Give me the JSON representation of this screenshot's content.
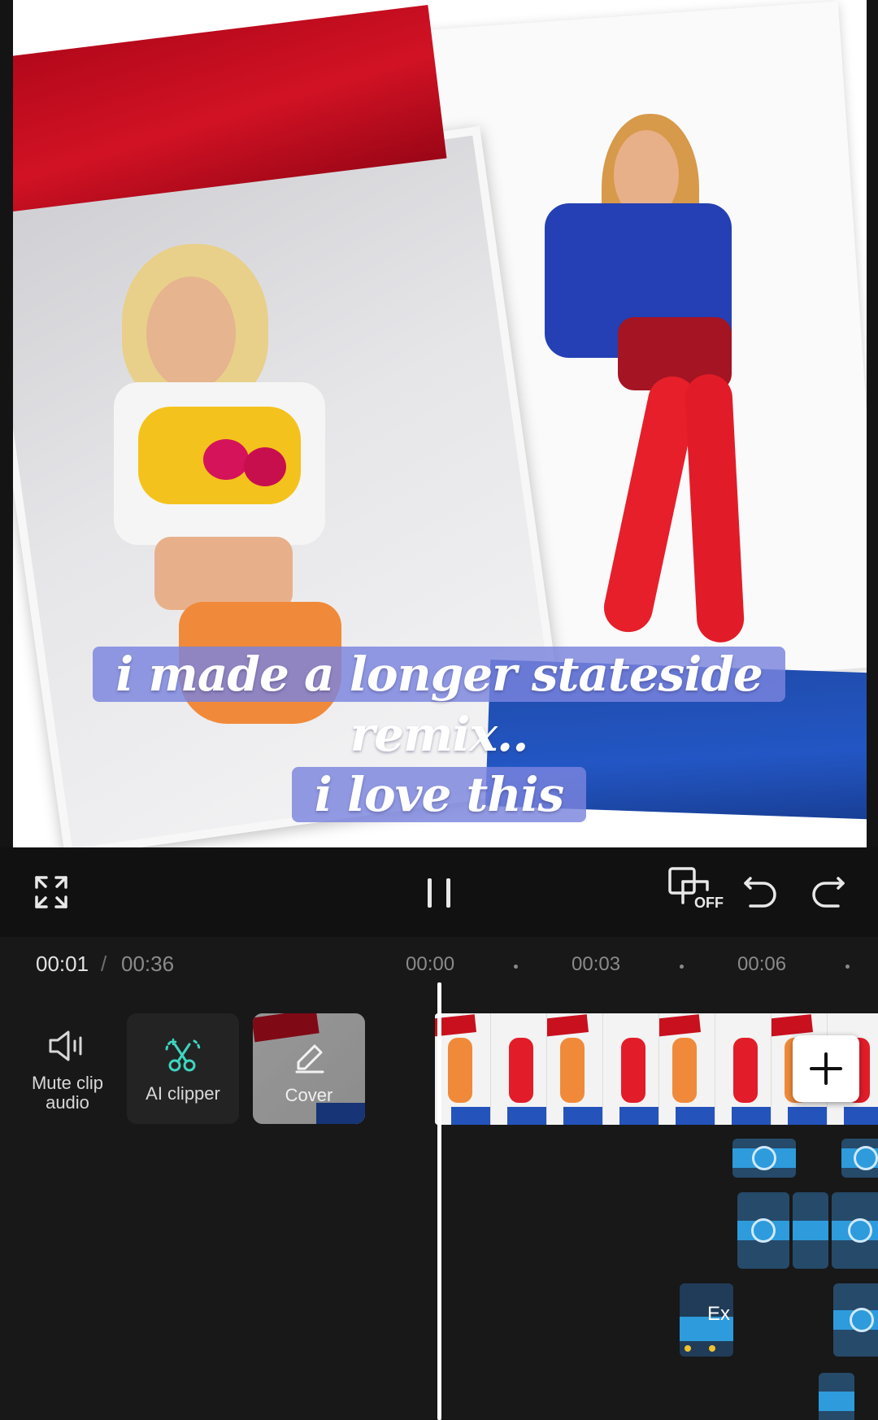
{
  "preview": {
    "caption_lines": [
      "i made a longer stateside",
      "remix..",
      "i love this"
    ]
  },
  "controls": {
    "fullscreen_icon": "fullscreen-icon",
    "pause_icon": "pause-icon",
    "keyframe_icon": "keyframe-off-icon",
    "keyframe_off_label": "OFF",
    "undo_icon": "undo-icon",
    "redo_icon": "redo-icon"
  },
  "time": {
    "current": "00:01",
    "separator": "/",
    "total": "00:36",
    "ticks": [
      "00:00",
      "00:03",
      "00:06"
    ]
  },
  "tools": {
    "mute_label_line1": "Mute clip",
    "mute_label_line2": "audio",
    "ai_clipper_label": "AI clipper",
    "cover_label": "Cover"
  },
  "timeline": {
    "add_icon": "plus-icon",
    "audio_clip_label": "Ex"
  },
  "colors": {
    "background": "#161616",
    "accent_teal": "#3dd6c0",
    "caption_bg": "#7a84de",
    "audio_wave": "#2e9bdc"
  }
}
